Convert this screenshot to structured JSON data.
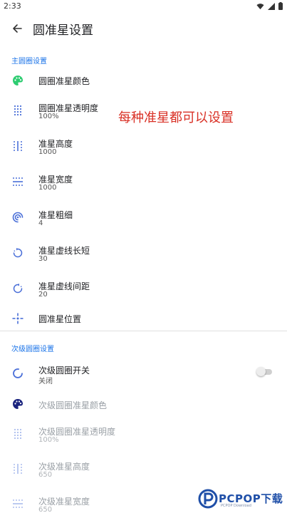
{
  "status_bar": {
    "time": "2:33"
  },
  "app_bar": {
    "title": "圆准星设置"
  },
  "annotation": "每种准星都可以设置",
  "sections": {
    "main": {
      "header": "主圆圈设置"
    },
    "secondary": {
      "header": "次级圆圈设置"
    }
  },
  "main_items": [
    {
      "title": "圆圈准星颜色",
      "summary": ""
    },
    {
      "title": "圆圈准星透明度",
      "summary": "100%"
    },
    {
      "title": "准星高度",
      "summary": "1000"
    },
    {
      "title": "准星宽度",
      "summary": "1000"
    },
    {
      "title": "准星粗细",
      "summary": "4"
    },
    {
      "title": "准星虚线长短",
      "summary": "30"
    },
    {
      "title": "准星虚线间距",
      "summary": "20"
    },
    {
      "title": "圆准星位置",
      "summary": ""
    }
  ],
  "secondary_items": [
    {
      "title": "次级圆圈开关",
      "summary": "关闭"
    },
    {
      "title": "次级圆圈准星颜色",
      "summary": ""
    },
    {
      "title": "次级圆圈准星透明度",
      "summary": "100%"
    },
    {
      "title": "次级准星高度",
      "summary": "650"
    },
    {
      "title": "次级准星宽度",
      "summary": "650"
    }
  ],
  "toggle": {
    "checked": false
  },
  "icons": {
    "back": "arrow-back-icon",
    "palette": "palette-icon",
    "opacity": "opacity-dots-icon",
    "height": "height-icon",
    "width": "width-icon",
    "thickness": "thickness-icon",
    "dash_length": "dash-length-icon",
    "dash_gap": "dash-gap-icon",
    "position": "crosshair-position-icon",
    "toggle": "circle-toggle-icon"
  },
  "colors": {
    "accent": "#1a73e8",
    "annotation": "#d93025",
    "palette_main": "#2ecc71",
    "palette_secondary": "#1a237e",
    "icon_blue": "#4a6fd8"
  },
  "watermark": {
    "brand": "PCPOP下载",
    "sub": "PCPOP Download"
  }
}
